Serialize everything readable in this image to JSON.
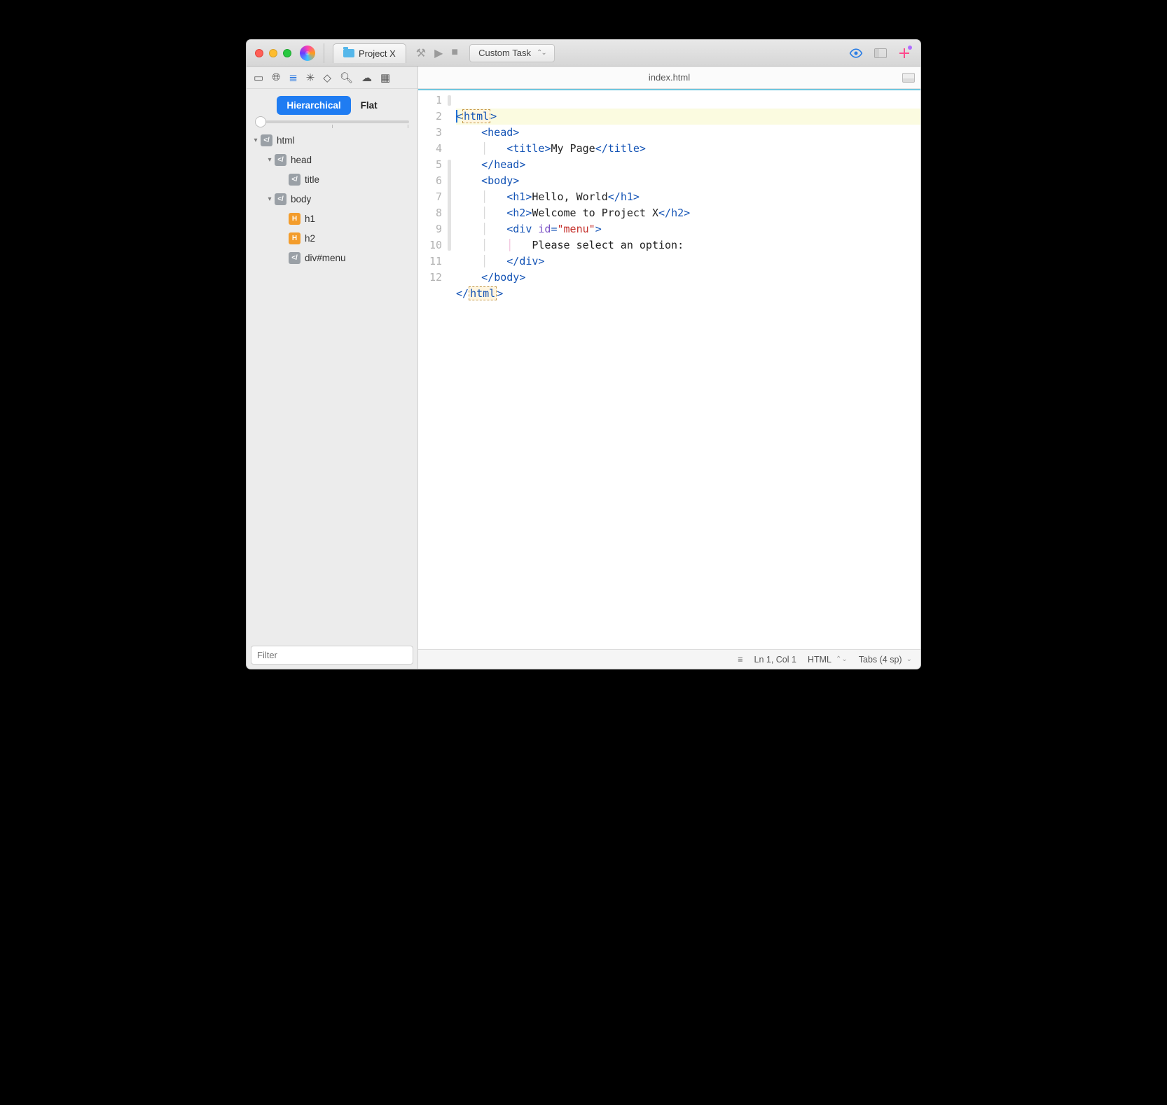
{
  "titlebar": {
    "project_tab": "Project X",
    "task_label": "Custom Task"
  },
  "sidebar": {
    "seg_hier": "Hierarchical",
    "seg_flat": "Flat",
    "tree": [
      {
        "indent": 0,
        "arrow": "▾",
        "icon": "el",
        "label": "html"
      },
      {
        "indent": 1,
        "arrow": "▾",
        "icon": "el",
        "label": "head"
      },
      {
        "indent": 2,
        "arrow": "",
        "icon": "el",
        "label": "title"
      },
      {
        "indent": 1,
        "arrow": "▾",
        "icon": "el",
        "label": "body"
      },
      {
        "indent": 2,
        "arrow": "",
        "icon": "h",
        "label": "h1"
      },
      {
        "indent": 2,
        "arrow": "",
        "icon": "h",
        "label": "h2"
      },
      {
        "indent": 2,
        "arrow": "",
        "icon": "el",
        "label": "div#menu"
      }
    ],
    "filter_placeholder": "Filter"
  },
  "document": {
    "filename": "index.html"
  },
  "code": {
    "lines": [
      1,
      2,
      3,
      4,
      5,
      6,
      7,
      8,
      9,
      10,
      11,
      12
    ],
    "t_html": "html",
    "t_head": "head",
    "t_title": "title",
    "t_body": "body",
    "t_h1": "h1",
    "t_h2": "h2",
    "t_div": "div",
    "attr_id": "id",
    "val_menu": "\"menu\"",
    "txt_title": "My Page",
    "txt_h1": "Hello, World",
    "txt_h2": "Welcome to Project X",
    "txt_menu": "Please select an option:"
  },
  "status": {
    "pos": "Ln 1, Col 1",
    "lang": "HTML",
    "indent": "Tabs (4 sp)"
  }
}
